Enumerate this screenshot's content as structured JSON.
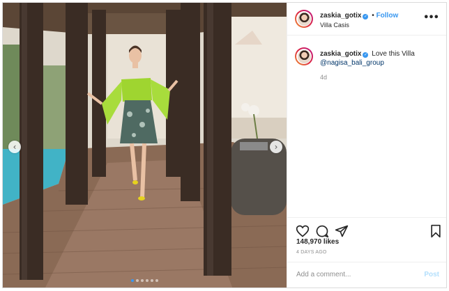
{
  "post": {
    "username": "zaskia_gotix",
    "location": "Villa Casis",
    "follow_label": "Follow",
    "separator": "•",
    "caption_text": "Love this Villa",
    "caption_tag": "@nagisa_bali_group",
    "time_ago": "4d",
    "likes": "148,970 likes",
    "date": "4 DAYS AGO",
    "comment_placeholder": "Add a comment...",
    "post_label": "Post",
    "verified_glyph": "✓",
    "more_glyph": "•••",
    "prev_glyph": "‹",
    "next_glyph": "›"
  },
  "carousel": {
    "slides": 6,
    "active": 1
  },
  "icons": [
    "verified-icon",
    "more-options-icon",
    "heart-icon",
    "comment-icon",
    "share-icon",
    "bookmark-icon",
    "carousel-prev-icon",
    "carousel-next-icon"
  ],
  "colors": {
    "accent": "#3897f0",
    "dress_top": "#9fd530",
    "post_disabled": "#b2dffc"
  }
}
